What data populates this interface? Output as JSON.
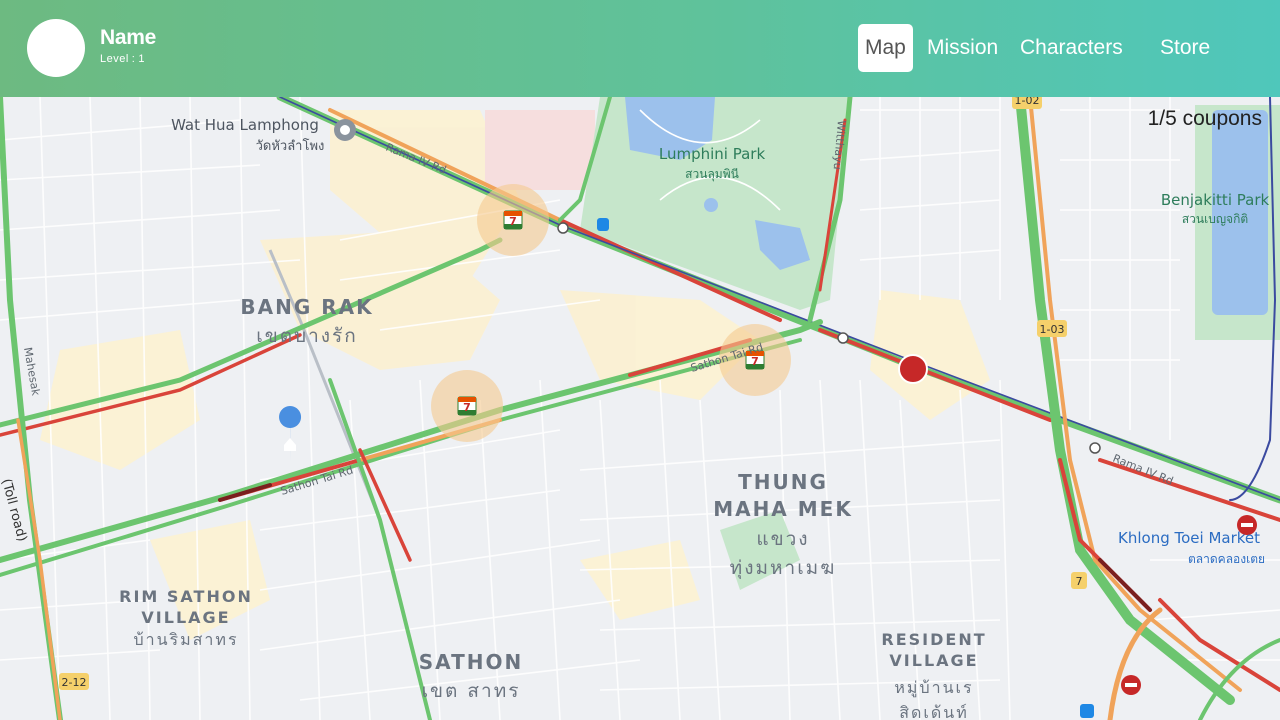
{
  "header": {
    "user_name": "Name",
    "level_label": "Level",
    "level_value": "1",
    "nav": [
      {
        "label": "Map",
        "active": true
      },
      {
        "label": "Mission",
        "active": false
      },
      {
        "label": "Characters",
        "active": false
      },
      {
        "label": "Store",
        "active": false
      }
    ]
  },
  "coupons": {
    "text": "1/5 coupons"
  },
  "map": {
    "districts": [
      {
        "name": "BANG RAK",
        "local": "เขตบางรัก"
      },
      {
        "name": "THUNG",
        "name2": "MAHA MEK",
        "local": "แขวง",
        "local2": "ทุ่งมหาเมฆ"
      },
      {
        "name": "RIM SATHON",
        "name2": "VILLAGE",
        "local": "บ้านริมสาทร"
      },
      {
        "name": "SATHON",
        "local": "เขต สาทร"
      },
      {
        "name": "RESIDENT",
        "name2": "VILLAGE",
        "local": "หมู่บ้านเร",
        "local2": "สิดเด้นท์"
      }
    ],
    "places": [
      {
        "name": "Wat Hua Lamphong",
        "local": "วัดหัวลำโพง"
      },
      {
        "name": "Lumphini Park",
        "local": "สวนลุมพินี"
      },
      {
        "name": "Benjakitti Park",
        "local": "สวนเบญจกิติ"
      },
      {
        "name": "Khlong Toei Market",
        "local": "ตลาดคลองเตย"
      }
    ],
    "roads": [
      "Rama IV Rd",
      "Sathon Tai Rd",
      "Sathon Tai Rd",
      "Rama IV Rd",
      "Mahesak",
      "(Toll road)",
      "Witthayu"
    ],
    "shields": [
      "1-02",
      "1-03",
      "2-12",
      "7"
    ],
    "colors": {
      "traffic_green": "#6cc56f",
      "traffic_orange": "#f0a35a",
      "traffic_red": "#d9443a",
      "park": "#c9e7cd",
      "water": "#9cc1ec",
      "store_halo": "#f5c98f",
      "marker": "#c62828"
    }
  }
}
